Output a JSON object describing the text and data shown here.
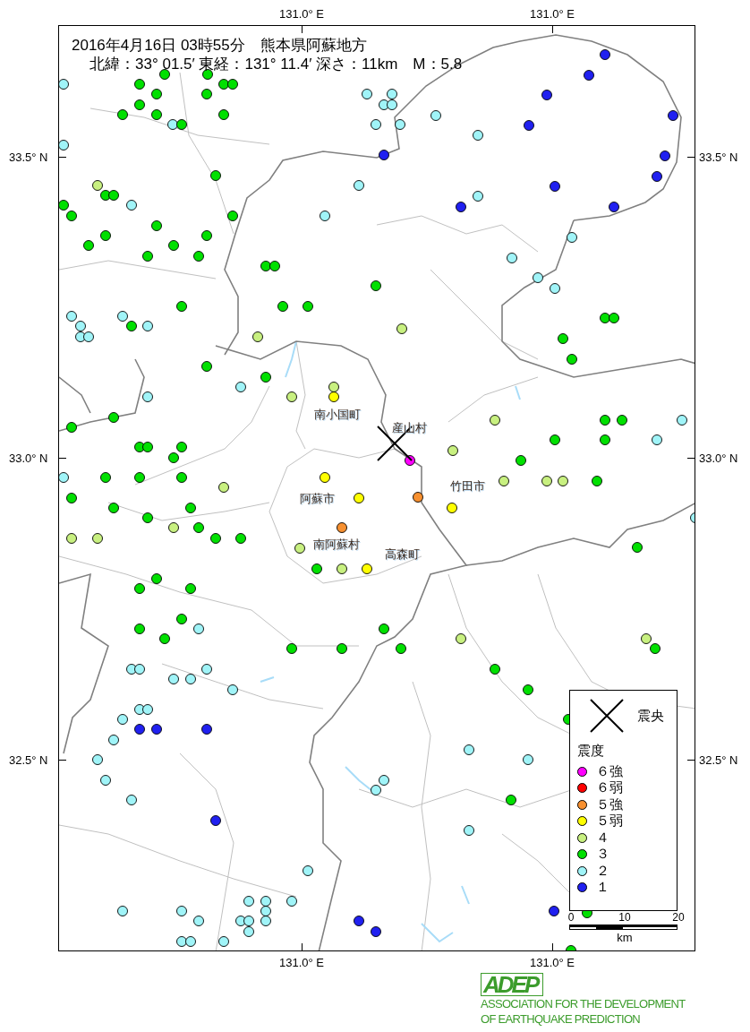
{
  "header": {
    "line_1": "2016年4月16日 03時55分　熊本県阿蘇地方",
    "line_2": "北緯：33° 01.5′ 東経：131° 11.4′ 深さ：11km　M：5.8"
  },
  "axes": {
    "top": [
      "131.0° E",
      "131.0° E"
    ],
    "bottom": [
      "131.0° E",
      "131.0° E"
    ],
    "left": [
      "33.5° N",
      "33.0° N",
      "32.5° N"
    ],
    "right": [
      "33.5° N",
      "33.0° N",
      "32.5° N"
    ]
  },
  "places": [
    {
      "name": "南小国町"
    },
    {
      "name": "産山村"
    },
    {
      "name": "阿蘇市"
    },
    {
      "name": "竹田市"
    },
    {
      "name": "南阿蘇村"
    },
    {
      "name": "高森町"
    }
  ],
  "stations": [
    {
      "color": "#a0f4f8"
    },
    {
      "color": "#00e000"
    },
    {
      "color": "#00e000"
    },
    {
      "color": "#00e000"
    },
    {
      "color": "#00e000"
    },
    {
      "color": "#00e000"
    },
    {
      "color": "#00e000"
    },
    {
      "color": "#00e000"
    },
    {
      "color": "#00e000"
    },
    {
      "color": "#00e000"
    },
    {
      "color": "#00e000"
    },
    {
      "color": "#00e000"
    },
    {
      "color": "#a0f4f8"
    },
    {
      "color": "#00e000"
    },
    {
      "color": "#a0f4f8"
    },
    {
      "color": "#a0f4f8"
    },
    {
      "color": "#a0f4f8"
    },
    {
      "color": "#a0f4f8"
    },
    {
      "color": "#a0f4f8"
    },
    {
      "color": "#a0f4f8"
    },
    {
      "color": "#a0f4f8"
    },
    {
      "color": "#a0f4f8"
    },
    {
      "color": "#2020f0"
    },
    {
      "color": "#a0f4f8"
    },
    {
      "color": "#00e000"
    },
    {
      "color": "#a0f4f8"
    },
    {
      "color": "#c8f080"
    },
    {
      "color": "#00e000"
    },
    {
      "color": "#00e000"
    },
    {
      "color": "#a0f4f8"
    },
    {
      "color": "#00e000"
    },
    {
      "color": "#00e000"
    },
    {
      "color": "#00e000"
    },
    {
      "color": "#a0f4f8"
    },
    {
      "color": "#00e000"
    },
    {
      "color": "#00e000"
    },
    {
      "color": "#00e000"
    },
    {
      "color": "#00e000"
    },
    {
      "color": "#00e000"
    },
    {
      "color": "#00e000"
    },
    {
      "color": "#00e000"
    },
    {
      "color": "#00e000"
    },
    {
      "color": "#00e000"
    },
    {
      "color": "#00e000"
    },
    {
      "color": "#00e000"
    },
    {
      "color": "#00e000"
    },
    {
      "color": "#00e000"
    },
    {
      "color": "#a0f4f8"
    },
    {
      "color": "#a0f4f8"
    },
    {
      "color": "#00e000"
    },
    {
      "color": "#a0f4f8"
    },
    {
      "color": "#a0f4f8"
    },
    {
      "color": "#a0f4f8"
    },
    {
      "color": "#a0f4f8"
    },
    {
      "color": "#c8f080"
    },
    {
      "color": "#00e000"
    },
    {
      "color": "#00e000"
    },
    {
      "color": "#a0f4f8"
    },
    {
      "color": "#c8f080"
    },
    {
      "color": "#c8f080"
    },
    {
      "color": "#ffff00"
    },
    {
      "color": "#a0f4f8"
    },
    {
      "color": "#00e000"
    },
    {
      "color": "#00e000"
    },
    {
      "color": "#00e000"
    },
    {
      "color": "#00e000"
    },
    {
      "color": "#00e000"
    },
    {
      "color": "#00e000"
    },
    {
      "color": "#a0f4f8"
    },
    {
      "color": "#00e000"
    },
    {
      "color": "#00e000"
    },
    {
      "color": "#00e000"
    },
    {
      "color": "#ffff00"
    },
    {
      "color": "#c8f080"
    },
    {
      "color": "#2020f0"
    },
    {
      "color": "#2020f0"
    },
    {
      "color": "#2020f0"
    },
    {
      "color": "#2020f0"
    },
    {
      "color": "#2020f0"
    },
    {
      "color": "#2020f0"
    },
    {
      "color": "#2020f0"
    },
    {
      "color": "#2020f0"
    },
    {
      "color": "#2020f0"
    },
    {
      "color": "#2020f0"
    },
    {
      "color": "#a0f4f8"
    },
    {
      "color": "#a0f4f8"
    },
    {
      "color": "#a0f4f8"
    },
    {
      "color": "#a0f4f8"
    },
    {
      "color": "#a0f4f8"
    },
    {
      "color": "#00e000"
    },
    {
      "color": "#00e000"
    },
    {
      "color": "#00e000"
    },
    {
      "color": "#00e000"
    },
    {
      "color": "#c8f080"
    },
    {
      "color": "#c8f080"
    },
    {
      "color": "#00e000"
    },
    {
      "color": "#00e000"
    },
    {
      "color": "#a0f4f8"
    },
    {
      "color": "#00e000"
    },
    {
      "color": "#00e000"
    },
    {
      "color": "#a0f4f8"
    },
    {
      "color": "#c8f080"
    },
    {
      "color": "#00e000"
    },
    {
      "color": "#ff00ff"
    },
    {
      "color": "#c8f080"
    },
    {
      "color": "#c8f080"
    },
    {
      "color": "#c8f080"
    },
    {
      "color": "#00e000"
    },
    {
      "color": "#f79030"
    },
    {
      "color": "#ffff00"
    },
    {
      "color": "#a0f4f8"
    },
    {
      "color": "#00e000"
    },
    {
      "color": "#c8f080"
    },
    {
      "color": "#00e000"
    },
    {
      "color": "#00e000"
    },
    {
      "color": "#00e000"
    },
    {
      "color": "#00e000"
    },
    {
      "color": "#00e000"
    },
    {
      "color": "#c8f080"
    },
    {
      "color": "#00e000"
    },
    {
      "color": "#c8f080"
    },
    {
      "color": "#c8f080"
    },
    {
      "color": "#00e000"
    },
    {
      "color": "#00e000"
    },
    {
      "color": "#ffff00"
    },
    {
      "color": "#f79030"
    },
    {
      "color": "#c8f080"
    },
    {
      "color": "#00e000"
    },
    {
      "color": "#c8f080"
    },
    {
      "color": "#ffff00"
    },
    {
      "color": "#00e000"
    },
    {
      "color": "#00e000"
    },
    {
      "color": "#00e000"
    },
    {
      "color": "#00e000"
    },
    {
      "color": "#00e000"
    },
    {
      "color": "#a0f4f8"
    },
    {
      "color": "#00e000"
    },
    {
      "color": "#00e000"
    },
    {
      "color": "#00e000"
    },
    {
      "color": "#00e000"
    },
    {
      "color": "#a0f4f8"
    },
    {
      "color": "#a0f4f8"
    },
    {
      "color": "#a0f4f8"
    },
    {
      "color": "#a0f4f8"
    },
    {
      "color": "#a0f4f8"
    },
    {
      "color": "#a0f4f8"
    },
    {
      "color": "#a0f4f8"
    },
    {
      "color": "#a0f4f8"
    },
    {
      "color": "#a0f4f8"
    },
    {
      "color": "#2020f0"
    },
    {
      "color": "#2020f0"
    },
    {
      "color": "#2020f0"
    },
    {
      "color": "#a0f4f8"
    },
    {
      "color": "#a0f4f8"
    },
    {
      "color": "#a0f4f8"
    },
    {
      "color": "#a0f4f8"
    },
    {
      "color": "#2020f0"
    },
    {
      "color": "#a0f4f8"
    },
    {
      "color": "#a0f4f8"
    },
    {
      "color": "#a0f4f8"
    },
    {
      "color": "#a0f4f8"
    },
    {
      "color": "#a0f4f8"
    },
    {
      "color": "#a0f4f8"
    },
    {
      "color": "#a0f4f8"
    },
    {
      "color": "#a0f4f8"
    },
    {
      "color": "#a0f4f8"
    },
    {
      "color": "#a0f4f8"
    },
    {
      "color": "#a0f4f8"
    },
    {
      "color": "#a0f4f8"
    },
    {
      "color": "#a0f4f8"
    },
    {
      "color": "#a0f4f8"
    },
    {
      "color": "#a0f4f8"
    },
    {
      "color": "#a0f4f8"
    },
    {
      "color": "#a0f4f8"
    },
    {
      "color": "#2020f0"
    },
    {
      "color": "#2020f0"
    },
    {
      "color": "#00e000"
    },
    {
      "color": "#c8f080"
    },
    {
      "color": "#00e000"
    },
    {
      "color": "#00e000"
    },
    {
      "color": "#00e000"
    },
    {
      "color": "#a0f4f8"
    },
    {
      "color": "#a0f4f8"
    },
    {
      "color": "#00e000"
    },
    {
      "color": "#a0f4f8"
    },
    {
      "color": "#2020f0"
    },
    {
      "color": "#00e000"
    },
    {
      "color": "#00e000"
    }
  ],
  "legend": {
    "epicenter_label": "震央",
    "intensity_title": "震度",
    "classes": [
      {
        "label": "６強",
        "color": "#ff00ff"
      },
      {
        "label": "６弱",
        "color": "#ff0000"
      },
      {
        "label": "５強",
        "color": "#f79030"
      },
      {
        "label": "５弱",
        "color": "#ffff00"
      },
      {
        "label": "４",
        "color": "#c8f080"
      },
      {
        "label": "３",
        "color": "#00e000"
      },
      {
        "label": "２",
        "color": "#a0f4f8"
      },
      {
        "label": "１",
        "color": "#2020f0"
      }
    ]
  },
  "scale": {
    "ticks": [
      "0",
      "10",
      "20"
    ],
    "unit": "km"
  },
  "logo": {
    "mark": "ADEP",
    "line_1": "ASSOCIATION FOR THE DEVELOPMENT",
    "line_2": "OF EARTHQUAKE PREDICTION"
  }
}
